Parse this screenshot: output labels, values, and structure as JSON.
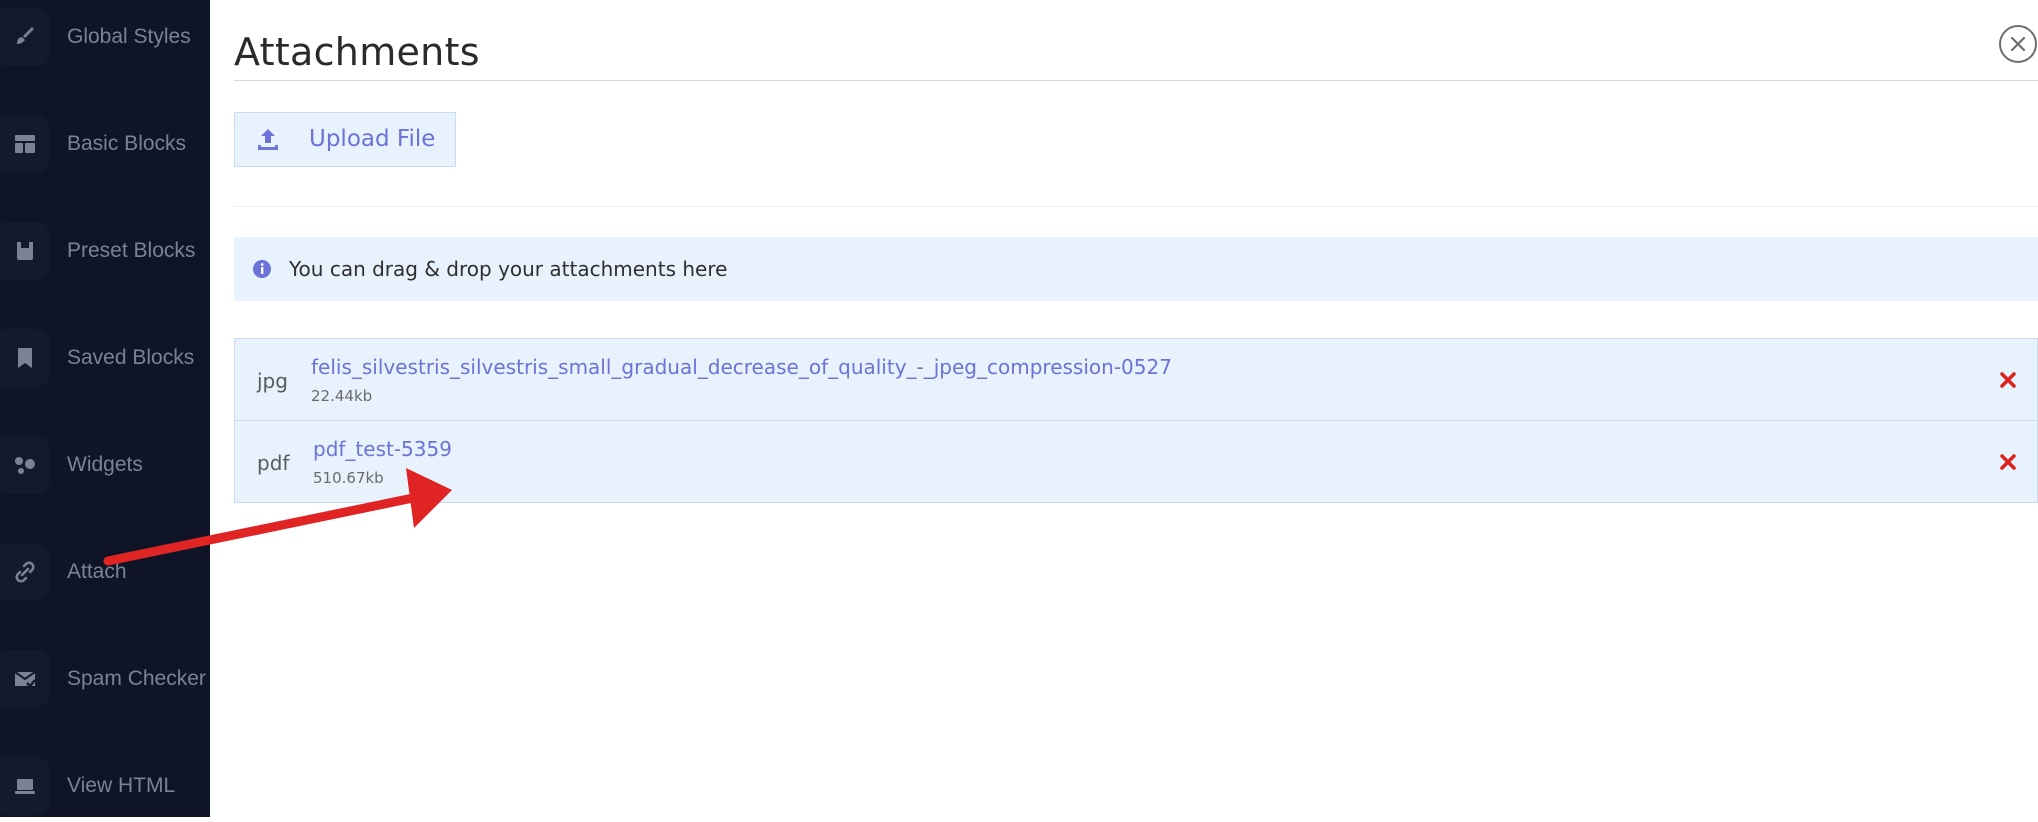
{
  "sidebar": {
    "items": [
      {
        "label": "Global Styles",
        "icon": "brush-icon"
      },
      {
        "label": "Basic Blocks",
        "icon": "layout-icon"
      },
      {
        "label": "Preset Blocks",
        "icon": "preset-icon"
      },
      {
        "label": "Saved Blocks",
        "icon": "bookmark-icon"
      },
      {
        "label": "Widgets",
        "icon": "widgets-icon"
      },
      {
        "label": "Attach",
        "icon": "paperclip-icon"
      },
      {
        "label": "Spam Checker",
        "icon": "mail-check-icon"
      },
      {
        "label": "View HTML",
        "icon": "laptop-icon"
      }
    ]
  },
  "panel": {
    "title": "Attachments",
    "upload_label": "Upload File",
    "info_text": "You can drag & drop your attachments here",
    "files": [
      {
        "ext": "jpg",
        "name": "felis_silvestris_silvestris_small_gradual_decrease_of_quality_-_jpeg_compression-0527",
        "size": "22.44kb"
      },
      {
        "ext": "pdf",
        "name": "pdf_test-5359",
        "size": "510.67kb"
      }
    ]
  },
  "colors": {
    "sidebar_bg": "#0f1526",
    "accent": "#6c72d8",
    "info_bg": "#e8f2fc",
    "remove": "#e0201a",
    "annotation_arrow": "#e02424"
  }
}
